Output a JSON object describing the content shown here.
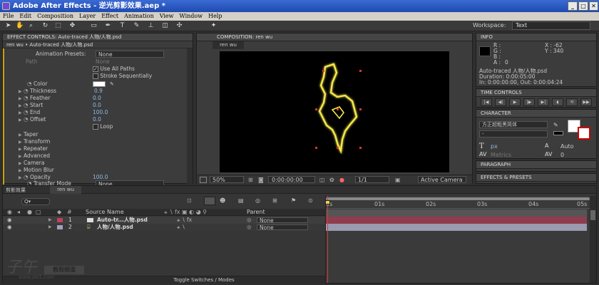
{
  "window": {
    "title": "Adobe After Effects - 逆光剪影效果.aep *",
    "min": "_",
    "max": "□",
    "close": "✕"
  },
  "menu": [
    "File",
    "Edit",
    "Composition",
    "Layer",
    "Effect",
    "Animation",
    "View",
    "Window",
    "Help"
  ],
  "workspace": {
    "label": "Workspace:",
    "value": "Text"
  },
  "effect_controls": {
    "tab": "EFFECT CONTROLS: Auto-traced 人物/人物.psd",
    "subtitle": "ren wu • Auto-traced 人物/人物.psd",
    "presets_label": "Animation Presets:",
    "presets_value": "None",
    "path_label": "Path",
    "path_value": "None",
    "use_all_paths": "Use All Paths",
    "stroke_seq": "Stroke Sequentially",
    "props": [
      {
        "name": "Color",
        "value": ""
      },
      {
        "name": "Thickness",
        "value": "0.9"
      },
      {
        "name": "Feather",
        "value": "0.0"
      },
      {
        "name": "Start",
        "value": "0.0"
      },
      {
        "name": "End",
        "value": "100.0"
      },
      {
        "name": "Offset",
        "value": "0.0"
      }
    ],
    "loop": "Loop",
    "groups": [
      "Taper",
      "Transform",
      "Repeater",
      "Advanced",
      "Camera",
      "Motion Blur"
    ],
    "opacity_label": "Opacity",
    "opacity_value": "100.0",
    "transfer_label": "Transfer Mode",
    "transfer_value": "None"
  },
  "composition": {
    "tab": "COMPOSITION: ren wu",
    "subtab": "ren wu",
    "zoom": "50%",
    "timecode": "0:00:00:00",
    "res": "1/1",
    "camera": "Active Camera"
  },
  "info": {
    "tab": "INFO",
    "r": "R :",
    "g": "G :",
    "b": "B :",
    "a": "A :",
    "a_val": "0",
    "x": "X : -62",
    "y": "Y : 340",
    "layer": "Auto-traced 人物/人物.psd",
    "duration": "Duration: 0:00:05:00",
    "inout": "In: 0:00:00:00, Out: 0:00:04:24"
  },
  "time_controls": {
    "tab": "TIME CONTROLS"
  },
  "character": {
    "tab": "CHARACTER",
    "font": "方正超粗黑简体",
    "style": "-",
    "size": "px",
    "leading": "Auto",
    "tracking_label": "Metrics",
    "tracking": "0"
  },
  "paragraph": {
    "tab": "PARAGRAPH"
  },
  "effects_presets": {
    "tab": "EFFECTS & PRESETS"
  },
  "timeline": {
    "tab1": "剪影效果",
    "tab2": "ren wu",
    "search": "Q▾",
    "col_source": "Source Name",
    "col_parent": "Parent",
    "layers": [
      {
        "num": "1",
        "name": "Auto-tr...人物.psd",
        "parent": "None"
      },
      {
        "num": "2",
        "name": "人物/人物.psd",
        "parent": "None"
      }
    ],
    "ruler": [
      "0s",
      "01s",
      "02s",
      "03s",
      "04s",
      "05s"
    ],
    "toggle": "Toggle Switches / Modes"
  },
  "watermark": {
    "text": "子午",
    "sub": "教程频道",
    "url": "www.zw5.com"
  },
  "colors": {
    "accent": "#3a6ad3",
    "stroke": "#f5e84a",
    "bar1": "#8f3c4e",
    "bar2": "#9a9ab0",
    "playhead": "#d23c3c"
  }
}
